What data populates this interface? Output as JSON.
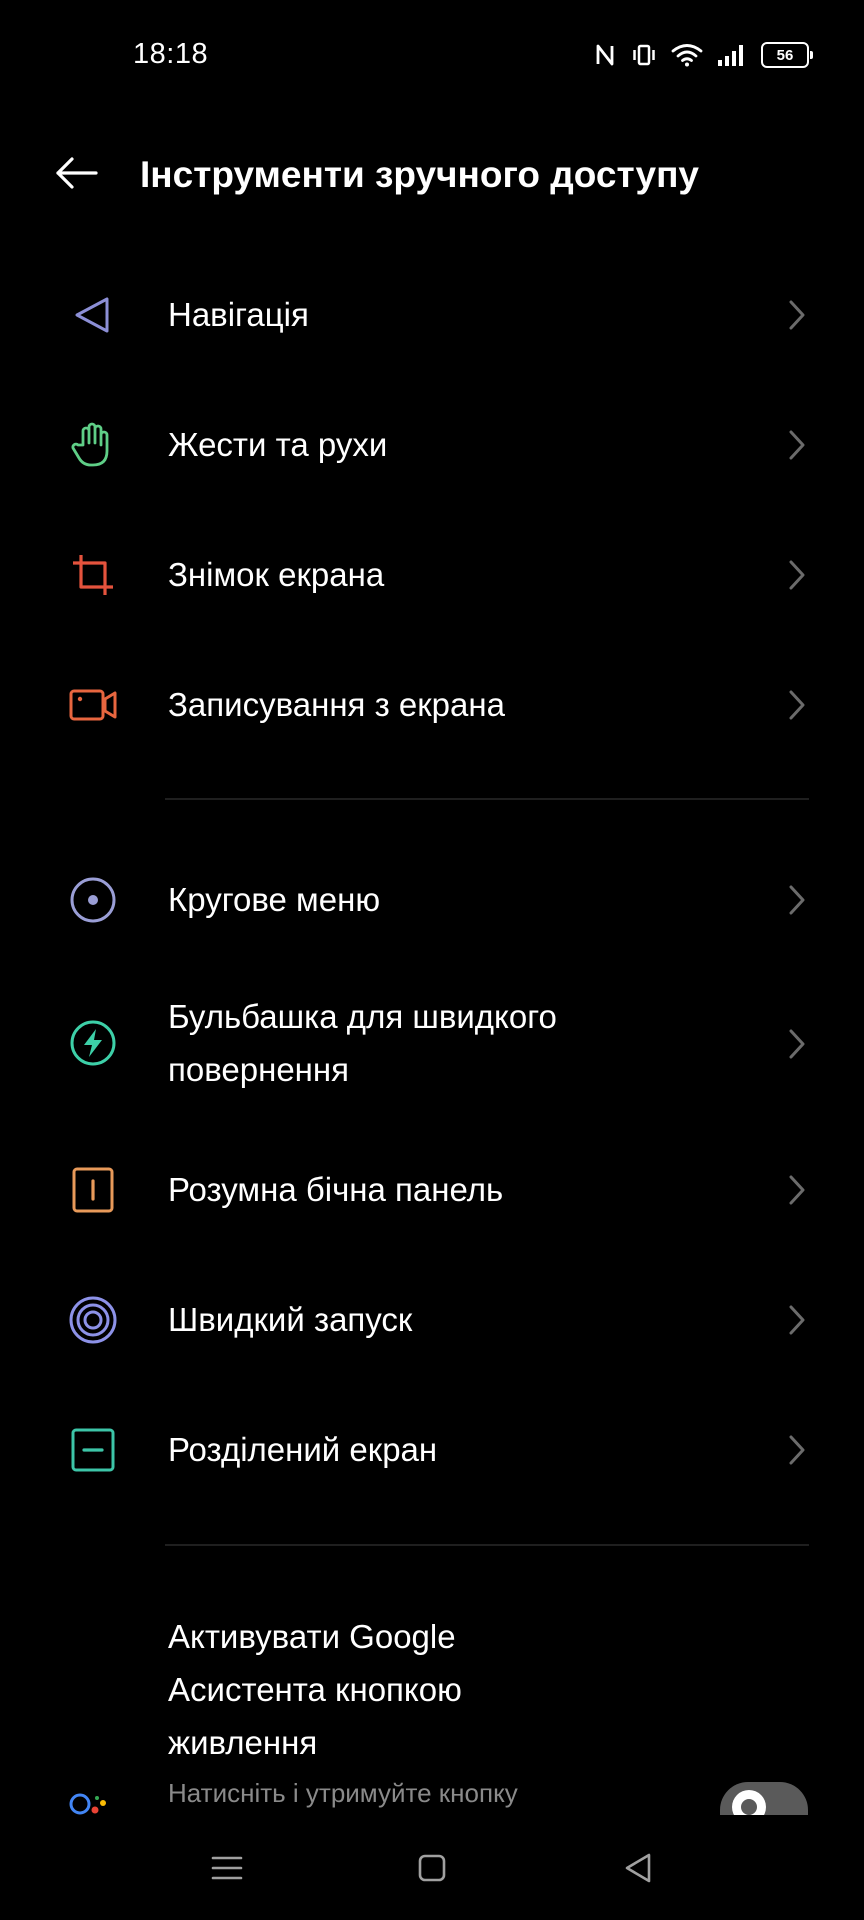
{
  "status_bar": {
    "time": "18:18",
    "icons": [
      "nfc-icon",
      "vibrate-icon",
      "wifi-icon",
      "signal-icon",
      "battery-icon"
    ],
    "battery_level": "56"
  },
  "header": {
    "back_icon": "arrow-left-icon",
    "title": "Інструменти зручного доступу"
  },
  "sections": [
    {
      "items": [
        {
          "label": "Навігація",
          "icon": "navigation-icon",
          "color": "#8c8fd6"
        },
        {
          "label": "Жести та рухи",
          "icon": "hand-gesture-icon",
          "color": "#5fcf87"
        },
        {
          "label": "Знімок екрана",
          "icon": "crop-screenshot-icon",
          "color": "#e5533d"
        },
        {
          "label": "Записування з екрана",
          "icon": "screen-record-icon",
          "color": "#e8663f"
        }
      ]
    },
    {
      "items": [
        {
          "label": "Кругове меню",
          "icon": "circle-menu-icon",
          "color": "#9a9ed6"
        },
        {
          "label": "Бульбашка для швидкого повернення",
          "icon": "quick-return-bubble-icon",
          "color": "#3dd0a8"
        },
        {
          "label": "Розумна бічна панель",
          "icon": "smart-sidebar-icon",
          "color": "#e89a5a"
        },
        {
          "label": "Швидкий запуск",
          "icon": "quick-launch-icon",
          "color": "#8d92e8"
        },
        {
          "label": "Розділений екран",
          "icon": "split-screen-icon",
          "color": "#3dc5a8"
        }
      ]
    }
  ],
  "assistant": {
    "title": "Активувати Google Асистента кнопкою живлення",
    "subtitle": "Натисніть і утримуйте кнопку",
    "icon": "google-assistant-icon",
    "toggle_on": false
  },
  "nav_bar": {
    "buttons": [
      "menu-icon",
      "home-square-icon",
      "back-triangle-icon"
    ]
  }
}
